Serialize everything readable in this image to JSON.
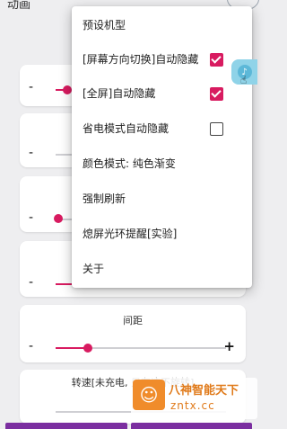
{
  "header": {
    "title_fragment": "动画"
  },
  "menu": {
    "items": [
      {
        "label": "预设机型",
        "checkbox": null
      },
      {
        "label": "[屏幕方向切换]自动隐藏",
        "checkbox": true
      },
      {
        "label": "[全屏]自动隐藏",
        "checkbox": true
      },
      {
        "label": "省电模式自动隐藏",
        "checkbox": false
      },
      {
        "label": "颜色模式: 纯色渐变",
        "checkbox": null
      },
      {
        "label": "强制刷新",
        "checkbox": null
      },
      {
        "label": "熄屏光环提醒[实验]",
        "checkbox": null
      },
      {
        "label": "关于",
        "checkbox": null
      }
    ]
  },
  "cards": {
    "minus": "-",
    "plus": "+",
    "spacing_label": "间距",
    "speed_label": "转速[未充电, 只有这不旋转]"
  },
  "watermark": {
    "line1": "八神智能天下",
    "line2": "zntx.cc"
  },
  "colors": {
    "accent": "#d81b60",
    "float": "#8fd3e8",
    "bottom": "#7b2ea0"
  }
}
